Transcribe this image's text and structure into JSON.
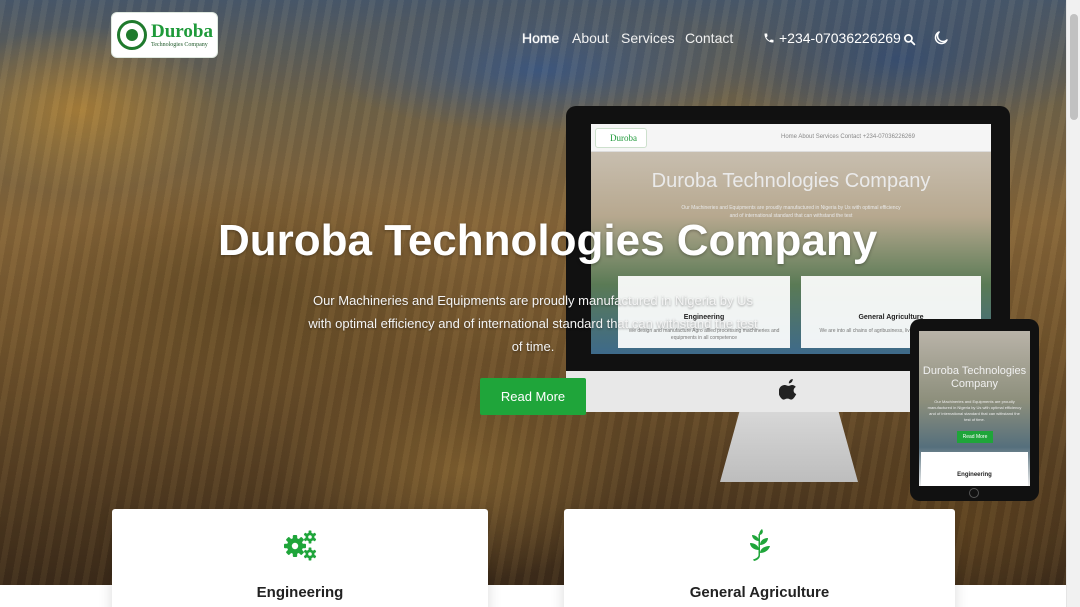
{
  "brand": {
    "name": "Duroba",
    "subtitle": "Technologies Company"
  },
  "nav": {
    "items": [
      {
        "label": "Home",
        "active": true
      },
      {
        "label": "About",
        "active": false
      },
      {
        "label": "Services",
        "active": false
      },
      {
        "label": "Contact",
        "active": false
      }
    ],
    "phone": "+234-07036226269"
  },
  "hero": {
    "title": "Duroba Technologies Company",
    "description": "Our Machineries and Equipments are proudly manufactured in Nigeria by Us with optimal efficiency and of international standard that can withstand the test of time.",
    "button_label": "Read More"
  },
  "mockup": {
    "monitor": {
      "logo": "Duroba",
      "links": "Home   About   Services   Contact        +234-07036226269",
      "title": "Duroba Technologies Company",
      "description": "Our Machineries and Equipments are proudly manufactured in Nigeria by Us with optimal efficiency and of international standard that can withstand the test",
      "card1_title": "Engineering",
      "card1_text": "We design and manufacture Agro allied processing machineries and equipments in all competence",
      "card2_title": "General Agriculture",
      "card2_text": "We are into all chains of agribusiness, livestocks, production and"
    },
    "tablet": {
      "title": "Duroba Technologies Company",
      "description": "Our Machineries and Equipments are proudly manufactured in Nigeria by Us with optimal efficiency and of international standard that can withstand the test of time.",
      "button_label": "Read More",
      "card_title": "Engineering"
    }
  },
  "features": [
    {
      "title": "Engineering",
      "icon": "gears-icon"
    },
    {
      "title": "General Agriculture",
      "icon": "leaf-sprout-icon"
    }
  ],
  "colors": {
    "accent": "#1fa53a",
    "brand_green": "#1f9a3a",
    "nav_text": "#ffffff"
  }
}
